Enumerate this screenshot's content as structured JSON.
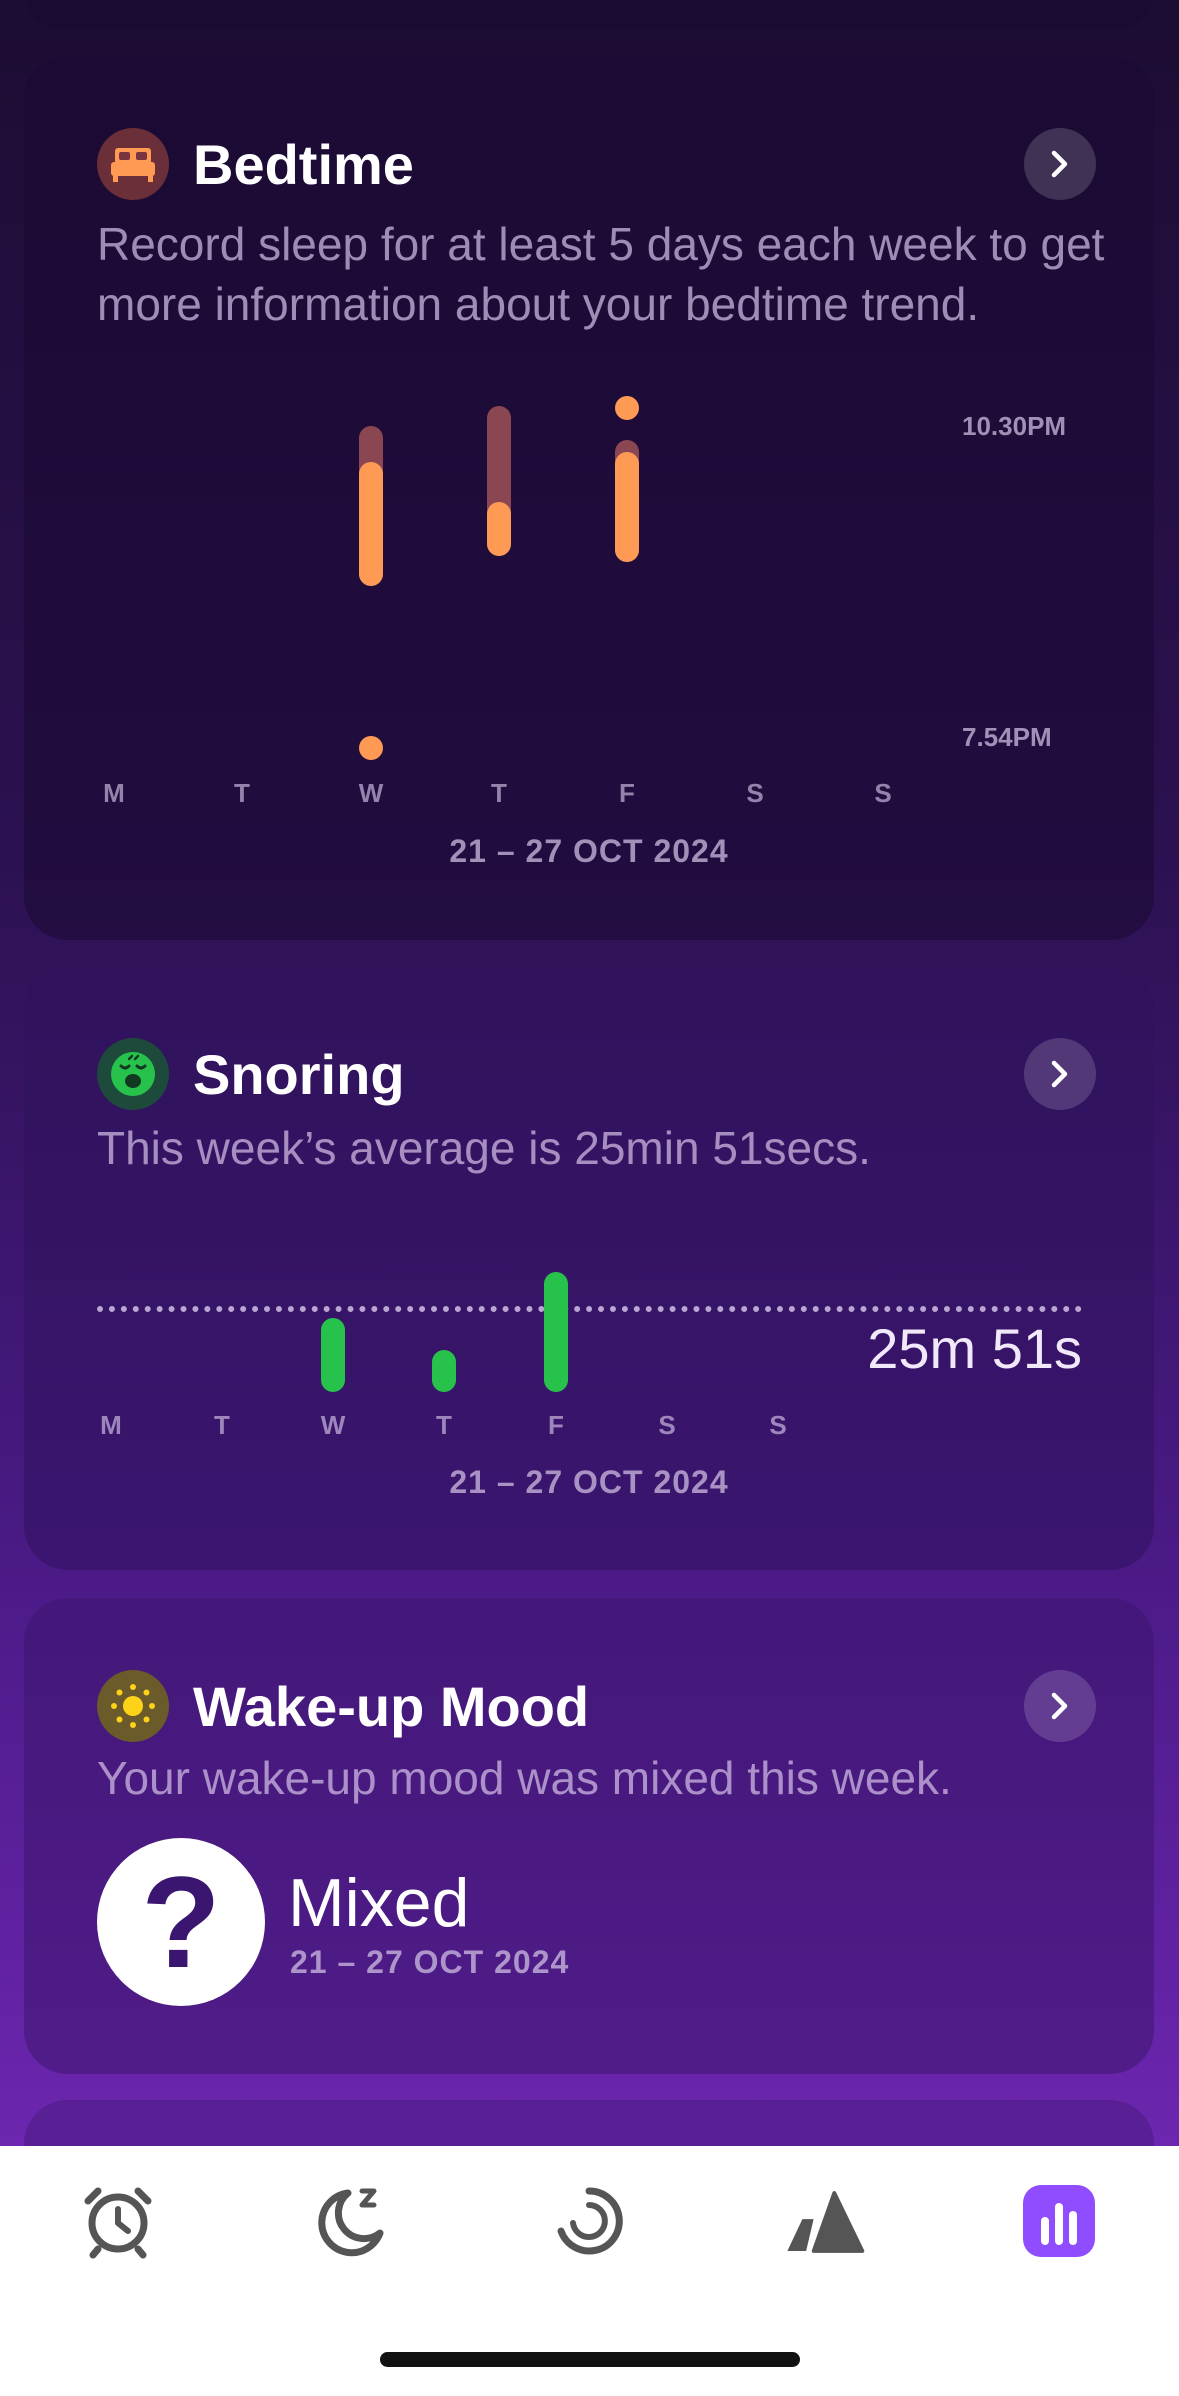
{
  "bedtime": {
    "title": "Bedtime",
    "icon": "bed-icon",
    "description": "Record sleep for at least 5 days each week to get more information about your bedtime trend.",
    "y_top_label": "10.30PM",
    "y_bottom_label": "7.54PM",
    "days": [
      "M",
      "T",
      "W",
      "T",
      "F",
      "S",
      "S"
    ],
    "date_range": "21 – 27 OCT 2024",
    "accent_color": "#ff9a55"
  },
  "snoring": {
    "title": "Snoring",
    "icon": "snoring-face-icon",
    "description": "This week’s average is 25min 51secs.",
    "average_label": "25m 51s",
    "days": [
      "M",
      "T",
      "W",
      "T",
      "F",
      "S",
      "S"
    ],
    "date_range": "21 – 27 OCT 2024",
    "accent_color": "#27c24c"
  },
  "mood": {
    "title": "Wake-up Mood",
    "icon": "sun-icon",
    "description": "Your wake-up mood was mixed this week.",
    "mood_symbol": "?",
    "mood_label": "Mixed",
    "date_range": "21 – 27 OCT 2024"
  },
  "tabs": [
    {
      "icon": "alarm-clock-icon",
      "active": false
    },
    {
      "icon": "sleep-moon-icon",
      "active": false
    },
    {
      "icon": "progress-ring-icon",
      "active": false
    },
    {
      "icon": "sound-cone-icon",
      "active": false
    },
    {
      "icon": "statistics-chart-icon",
      "active": true
    }
  ]
}
